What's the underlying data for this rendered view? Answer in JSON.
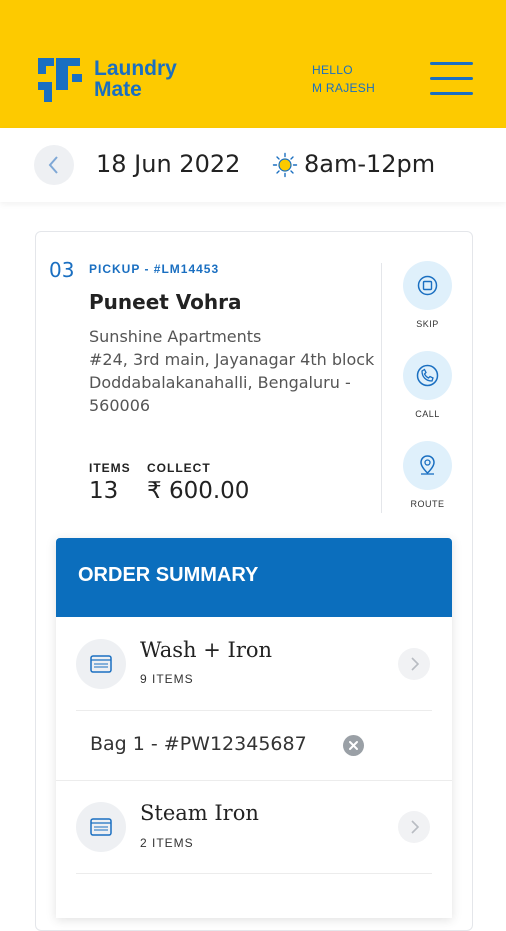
{
  "header": {
    "brand_line1": "Laundry",
    "brand_line2": "Mate",
    "greeting_line1": "HELLO",
    "greeting_line2": "M RAJESH",
    "accent": "#fdca00",
    "brand_color": "#1a6fc1"
  },
  "schedule": {
    "date": "18 Jun 2022",
    "time_slot": "8am-12pm",
    "back_icon": "chevron-left-icon",
    "time_icon": "sun-icon"
  },
  "stop": {
    "number": "03",
    "pickup_label": "PICKUP - #LM14453",
    "customer_name": "Puneet Vohra",
    "address_lines": [
      "Sunshine Apartments",
      "#24, 3rd main, Jayanagar 4th block",
      "Doddabalakanahalli, Bengaluru -",
      "560006"
    ],
    "items_label": "ITEMS",
    "items_value": "13",
    "collect_label": "COLLECT",
    "collect_value": "₹ 600.00"
  },
  "actions": [
    {
      "label": "SKIP",
      "icon": "skip-icon"
    },
    {
      "label": "CALL",
      "icon": "phone-icon"
    },
    {
      "label": "ROUTE",
      "icon": "location-pin-icon"
    }
  ],
  "summary": {
    "title": "ORDER SUMMARY",
    "header_color": "#0b6ebd",
    "services": [
      {
        "name": "Wash + Iron",
        "items": "9 ITEMS",
        "icon": "washing-machine-icon"
      },
      {
        "name": "Steam Iron",
        "items": "2 ITEMS",
        "icon": "washing-machine-icon"
      }
    ],
    "bag": "Bag 1 - #PW12345687"
  }
}
